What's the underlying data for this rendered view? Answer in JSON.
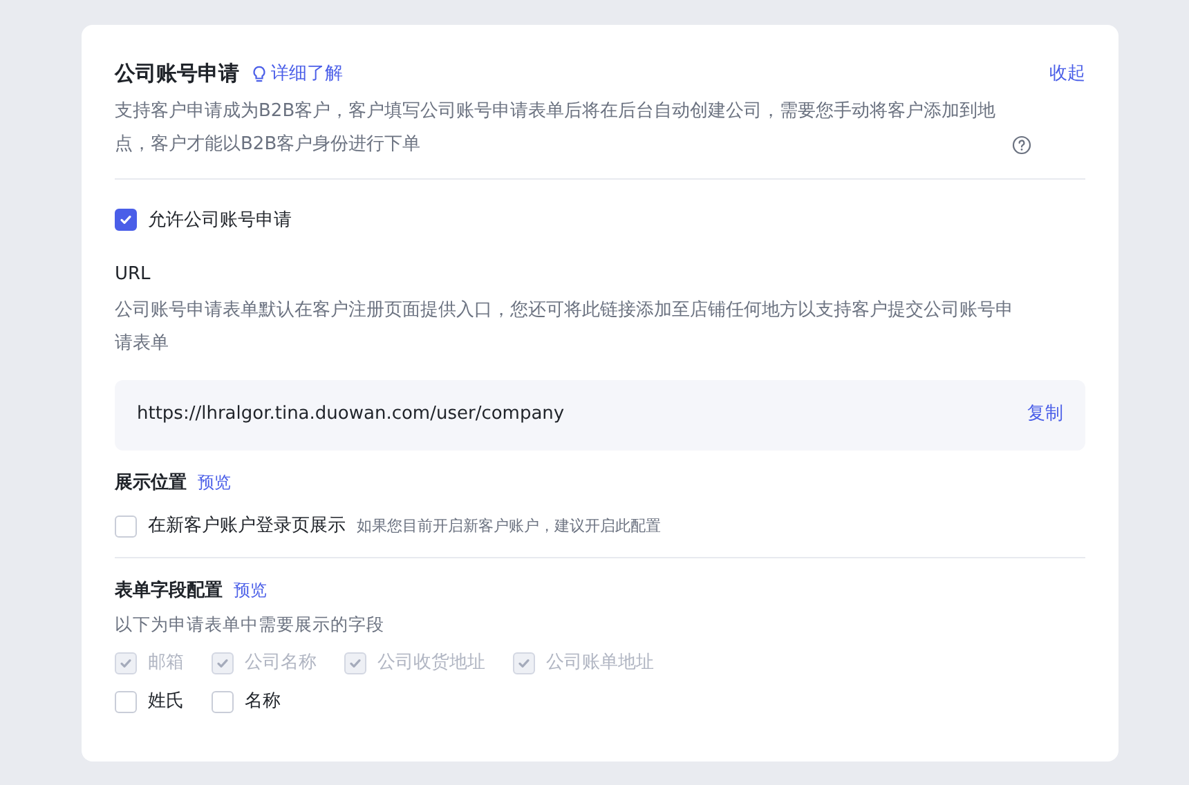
{
  "header": {
    "title": "公司账号申请",
    "learn_more": "详细了解",
    "collapse": "收起",
    "description": "支持客户申请成为B2B客户，客户填写公司账号申请表单后将在后台自动创建公司，需要您手动将客户添加到地点，客户才能以B2B客户身份进行下单"
  },
  "allow": {
    "label": "允许公司账号申请",
    "checked": true
  },
  "url": {
    "title": "URL",
    "description": "公司账号申请表单默认在客户注册页面提供入口，您还可将此链接添加至店铺任何地方以支持客户提交公司账号申请表单",
    "value": "https://lhralgor.tina.duowan.com/user/company",
    "copy": "复制"
  },
  "display": {
    "title": "展示位置",
    "preview": "预览",
    "option": {
      "label": "在新客户账户登录页展示",
      "hint": "如果您目前开启新客户账户，建议开启此配置",
      "checked": false
    }
  },
  "form_fields": {
    "title": "表单字段配置",
    "preview": "预览",
    "description": "以下为申请表单中需要展示的字段",
    "rows": [
      [
        {
          "label": "邮箱",
          "checked": true,
          "disabled": true
        },
        {
          "label": "公司名称",
          "checked": true,
          "disabled": true
        },
        {
          "label": "公司收货地址",
          "checked": true,
          "disabled": true
        },
        {
          "label": "公司账单地址",
          "checked": true,
          "disabled": true
        }
      ],
      [
        {
          "label": "姓氏",
          "checked": false,
          "disabled": false
        },
        {
          "label": "名称",
          "checked": false,
          "disabled": false
        }
      ]
    ]
  }
}
